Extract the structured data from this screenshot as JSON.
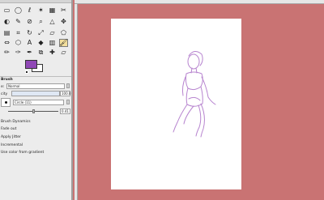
{
  "toolbox": {
    "tools": [
      {
        "name": "rect-select-tool-icon",
        "glyph": "▭"
      },
      {
        "name": "ellipse-select-tool-icon",
        "glyph": "◯"
      },
      {
        "name": "free-select-tool-icon",
        "glyph": "ℓ"
      },
      {
        "name": "fuzzy-select-tool-icon",
        "glyph": "✶"
      },
      {
        "name": "color-select-tool-icon",
        "glyph": "▦"
      },
      {
        "name": "scissors-select-tool-icon",
        "glyph": "✂"
      },
      {
        "name": "foreground-select-tool-icon",
        "glyph": "◐"
      },
      {
        "name": "paths-tool-icon",
        "glyph": "✎"
      },
      {
        "name": "color-picker-tool-icon",
        "glyph": "⊘"
      },
      {
        "name": "zoom-tool-icon",
        "glyph": "⌕"
      },
      {
        "name": "measure-tool-icon",
        "glyph": "△"
      },
      {
        "name": "move-tool-icon",
        "glyph": "✥"
      },
      {
        "name": "align-tool-icon",
        "glyph": "▤"
      },
      {
        "name": "crop-tool-icon",
        "glyph": "⌗"
      },
      {
        "name": "rotate-tool-icon",
        "glyph": "↻"
      },
      {
        "name": "scale-tool-icon",
        "glyph": "⤢"
      },
      {
        "name": "shear-tool-icon",
        "glyph": "▱"
      },
      {
        "name": "perspective-tool-icon",
        "glyph": "⬠"
      },
      {
        "name": "flip-tool-icon",
        "glyph": "⇔"
      },
      {
        "name": "cage-transform-tool-icon",
        "glyph": "⬡"
      },
      {
        "name": "text-tool-icon",
        "glyph": "A"
      },
      {
        "name": "bucket-fill-tool-icon",
        "glyph": "◆"
      },
      {
        "name": "blend-tool-icon",
        "glyph": "▥"
      },
      {
        "name": "paintbrush-tool-icon",
        "glyph": "🖌"
      },
      {
        "name": "pencil-tool-icon",
        "glyph": "✏"
      },
      {
        "name": "airbrush-tool-icon",
        "glyph": "✑"
      },
      {
        "name": "ink-tool-icon",
        "glyph": "✒"
      },
      {
        "name": "clone-tool-icon",
        "glyph": "⧉"
      },
      {
        "name": "heal-tool-icon",
        "glyph": "✚"
      },
      {
        "name": "eraser-tool-icon",
        "glyph": "▱"
      }
    ],
    "colors": {
      "foreground": "#9048b6",
      "background": "#ffffff"
    }
  },
  "tool_options": {
    "title": "Brush",
    "mode_label": "e:",
    "mode_value": "Normal",
    "opacity_label": "city",
    "opacity_value": "100.0",
    "brush_name": "Circle (11)",
    "size_value": "0.41",
    "dynamics_label": "Brush Dynamics",
    "fade_label": "Fade out",
    "jitter_label": "Apply Jitter",
    "incremental_label": "Incremental",
    "gradient_label": "Use color from gradient"
  },
  "canvas": {
    "area_color": "#c97373",
    "paper_color": "#ffffff",
    "sketch_color": "#b784cf"
  }
}
